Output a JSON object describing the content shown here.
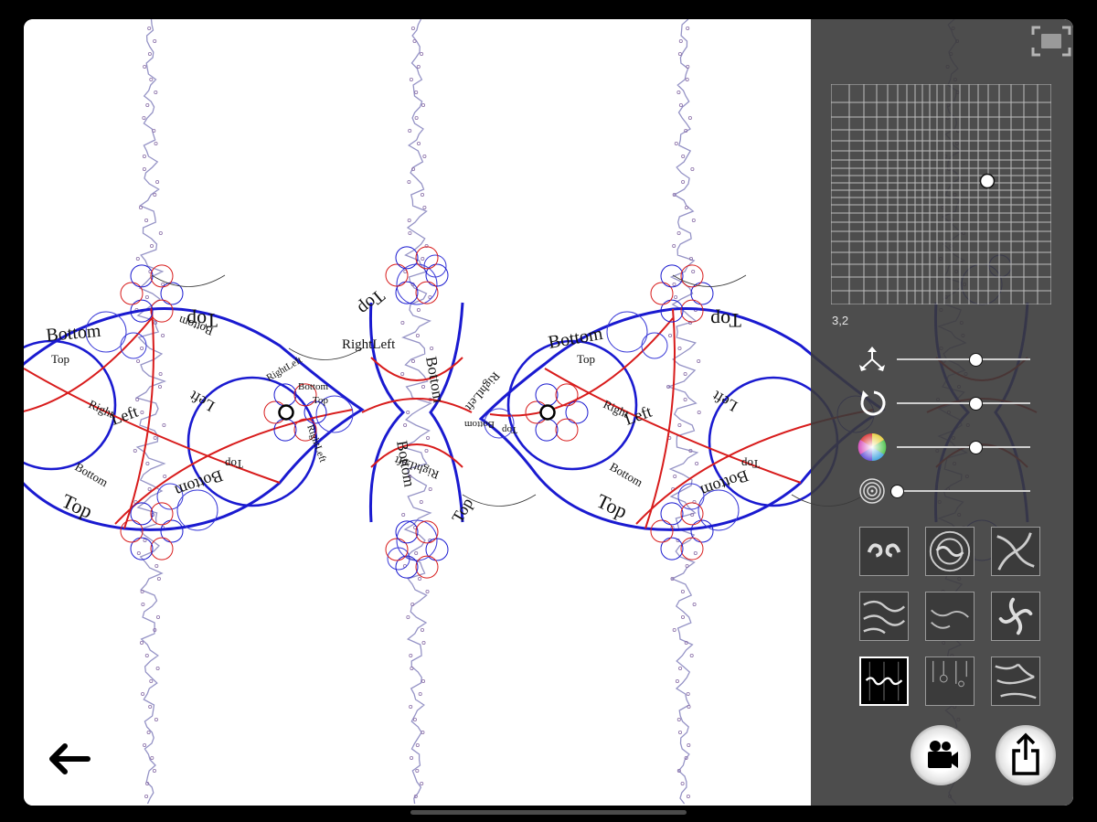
{
  "canvas": {
    "labels": {
      "top": "Top",
      "bottom": "Bottom",
      "left": "Left",
      "right": "Right",
      "right_left": "RightLeft"
    },
    "colors": {
      "blue": "#1a1ad0",
      "red": "#d81c1c",
      "background": "#ffffff"
    }
  },
  "panel": {
    "grid_value": "3,2",
    "grid_cell_selected": [
      3,
      2
    ],
    "sliders": [
      {
        "name": "translate",
        "icon": "move-arrows-icon",
        "value": 0.59
      },
      {
        "name": "rotate",
        "icon": "rotate-icon",
        "value": 0.59
      },
      {
        "name": "color",
        "icon": "color-wheel-icon",
        "value": 0.59
      },
      {
        "name": "spiral",
        "icon": "concentric-circles-icon",
        "value": 0.0
      }
    ],
    "presets": [
      {
        "name": "preset-swirl-pair",
        "selected": false
      },
      {
        "name": "preset-spiral-rings",
        "selected": false
      },
      {
        "name": "preset-vortex",
        "selected": false
      },
      {
        "name": "preset-waves",
        "selected": false
      },
      {
        "name": "preset-flow",
        "selected": false
      },
      {
        "name": "preset-pinwheel",
        "selected": false
      },
      {
        "name": "preset-fractal-strip",
        "selected": true
      },
      {
        "name": "preset-drip",
        "selected": false
      },
      {
        "name": "preset-tiles",
        "selected": false
      }
    ],
    "buttons": {
      "record": "video-camera-icon",
      "share": "share-icon",
      "fullscreen": "fullscreen-icon",
      "back": "back-arrow-icon"
    }
  }
}
